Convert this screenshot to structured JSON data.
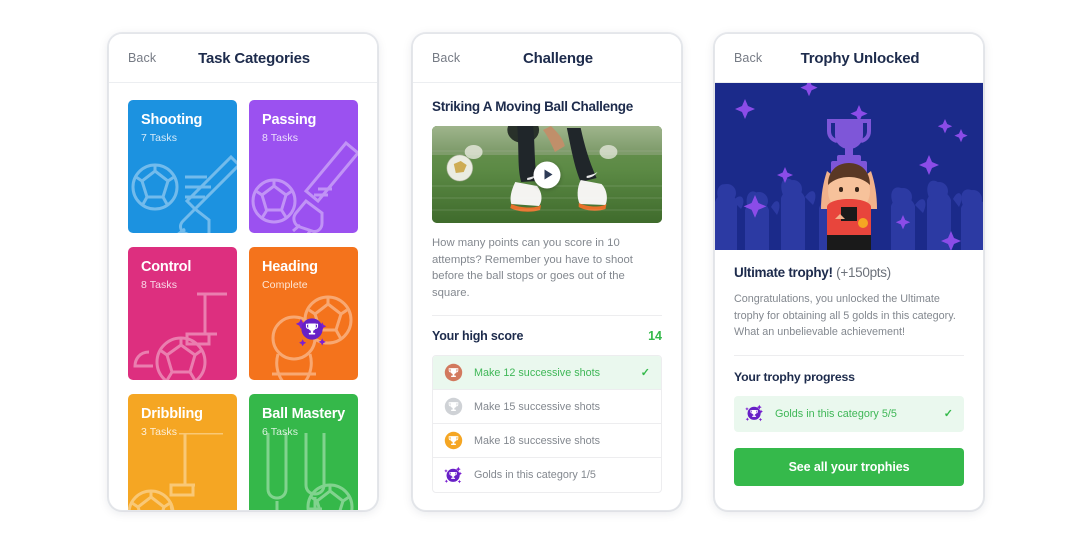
{
  "screens": [
    {
      "id": "task-categories",
      "nav": {
        "back": "Back",
        "title": "Task Categories"
      },
      "categories": [
        {
          "name": "Shooting",
          "sub": "7 Tasks",
          "color": "#1c92e0",
          "art": "shooting",
          "badge": false
        },
        {
          "name": "Passing",
          "sub": "8 Tasks",
          "color": "#9b51f0",
          "art": "passing",
          "badge": false
        },
        {
          "name": "Control",
          "sub": "8 Tasks",
          "color": "#dd2f7f",
          "art": "control",
          "badge": false
        },
        {
          "name": "Heading",
          "sub": "Complete",
          "color": "#f4731c",
          "art": "heading",
          "badge": true
        },
        {
          "name": "Dribbling",
          "sub": "3 Tasks",
          "color": "#f5a623",
          "art": "dribbling",
          "badge": false
        },
        {
          "name": "Ball Mastery",
          "sub": "6 Tasks",
          "color": "#35b84a",
          "art": "mastery",
          "badge": false
        }
      ]
    },
    {
      "id": "challenge",
      "nav": {
        "back": "Back",
        "title": "Challenge"
      },
      "title": "Striking A Moving Ball Challenge",
      "video": {
        "play_label": "play-button",
        "alt": "Football player striking a ball on grass pitch"
      },
      "description": "How many points can you score in 10 attempts? Remember you have to shoot before the ball stops or goes out of the square.",
      "high_score": {
        "label": "Your high score",
        "value": "14"
      },
      "achievements": [
        {
          "text": "Make 12 successive shots",
          "medal": "bronze",
          "done": true,
          "check": "✓"
        },
        {
          "text": "Make 15 successive shots",
          "medal": "silver",
          "done": false,
          "check": ""
        },
        {
          "text": "Make 18 successive shots",
          "medal": "gold",
          "done": false,
          "check": ""
        },
        {
          "text": "Golds in this category 1/5",
          "medal": "ultimate",
          "done": false,
          "check": ""
        }
      ]
    },
    {
      "id": "trophy-unlocked",
      "nav": {
        "back": "Back",
        "title": "Trophy Unlocked"
      },
      "hero": {
        "alt": "Player lifting a purple trophy in front of a crowd"
      },
      "heading_bold": "Ultimate trophy!",
      "heading_points": "(+150pts)",
      "description": "Congratulations, you unlocked the Ultimate trophy for obtaining all 5 golds in this category. What an unbelievable achievement!",
      "progress_label": "Your trophy progress",
      "progress_row": {
        "text": "Golds in this category 5/5",
        "medal": "ultimate",
        "check": "✓"
      },
      "cta_label": "See all your trophies"
    }
  ],
  "colors": {
    "navy": "#1d2b4c",
    "green": "#35b94b",
    "green_soft_bg": "#eaf8ee",
    "grey_text": "#83888f",
    "bronze": "#d2795e",
    "silver": "#cfd2d6",
    "gold": "#f5a623",
    "ultimate": "#7b1fd1",
    "hero_bg": "#1b2a8a",
    "trophy_purple": "#7e56d8"
  }
}
